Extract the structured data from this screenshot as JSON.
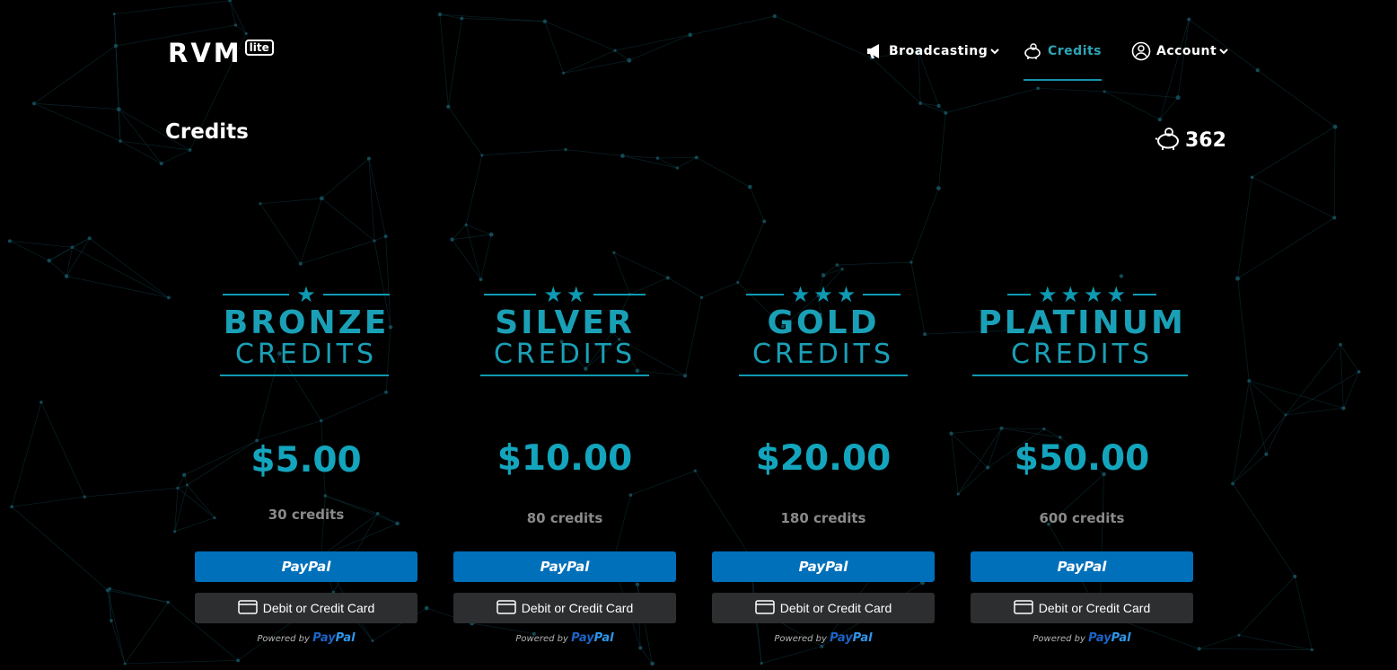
{
  "header": {
    "logo_text": "RVM",
    "logo_sub": "lite",
    "nav": [
      {
        "label": "Broadcasting",
        "icon": "megaphone-icon",
        "has_dropdown": true,
        "active": false
      },
      {
        "label": "Credits",
        "icon": "piggy-bank-icon",
        "has_dropdown": false,
        "active": true
      },
      {
        "label": "Account",
        "icon": "user-circle-icon",
        "has_dropdown": true,
        "active": false
      }
    ]
  },
  "page": {
    "title": "Credits",
    "balance": "362",
    "balance_icon": "piggy-bank-icon"
  },
  "tiers": [
    {
      "stars": 1,
      "name": "BRONZE",
      "subtitle": "CREDITS",
      "price": "$5.00",
      "credits": "30 credits"
    },
    {
      "stars": 2,
      "name": "SILVER",
      "subtitle": "CREDITS",
      "price": "$10.00",
      "credits": "80 credits"
    },
    {
      "stars": 3,
      "name": "GOLD",
      "subtitle": "CREDITS",
      "price": "$20.00",
      "credits": "180 credits"
    },
    {
      "stars": 4,
      "name": "PLATINUM",
      "subtitle": "CREDITS",
      "price": "$50.00",
      "credits": "600 credits"
    }
  ],
  "payment": {
    "paypal_label": "PayPal",
    "card_label": "Debit or Credit Card",
    "powered_by": "Powered by",
    "powered_brand_a": "Pay",
    "powered_brand_b": "Pal"
  },
  "colors": {
    "background": "#000000",
    "accent": "#1592a8",
    "paypal_blue": "#0070ba",
    "card_button": "#2c2e2f"
  }
}
